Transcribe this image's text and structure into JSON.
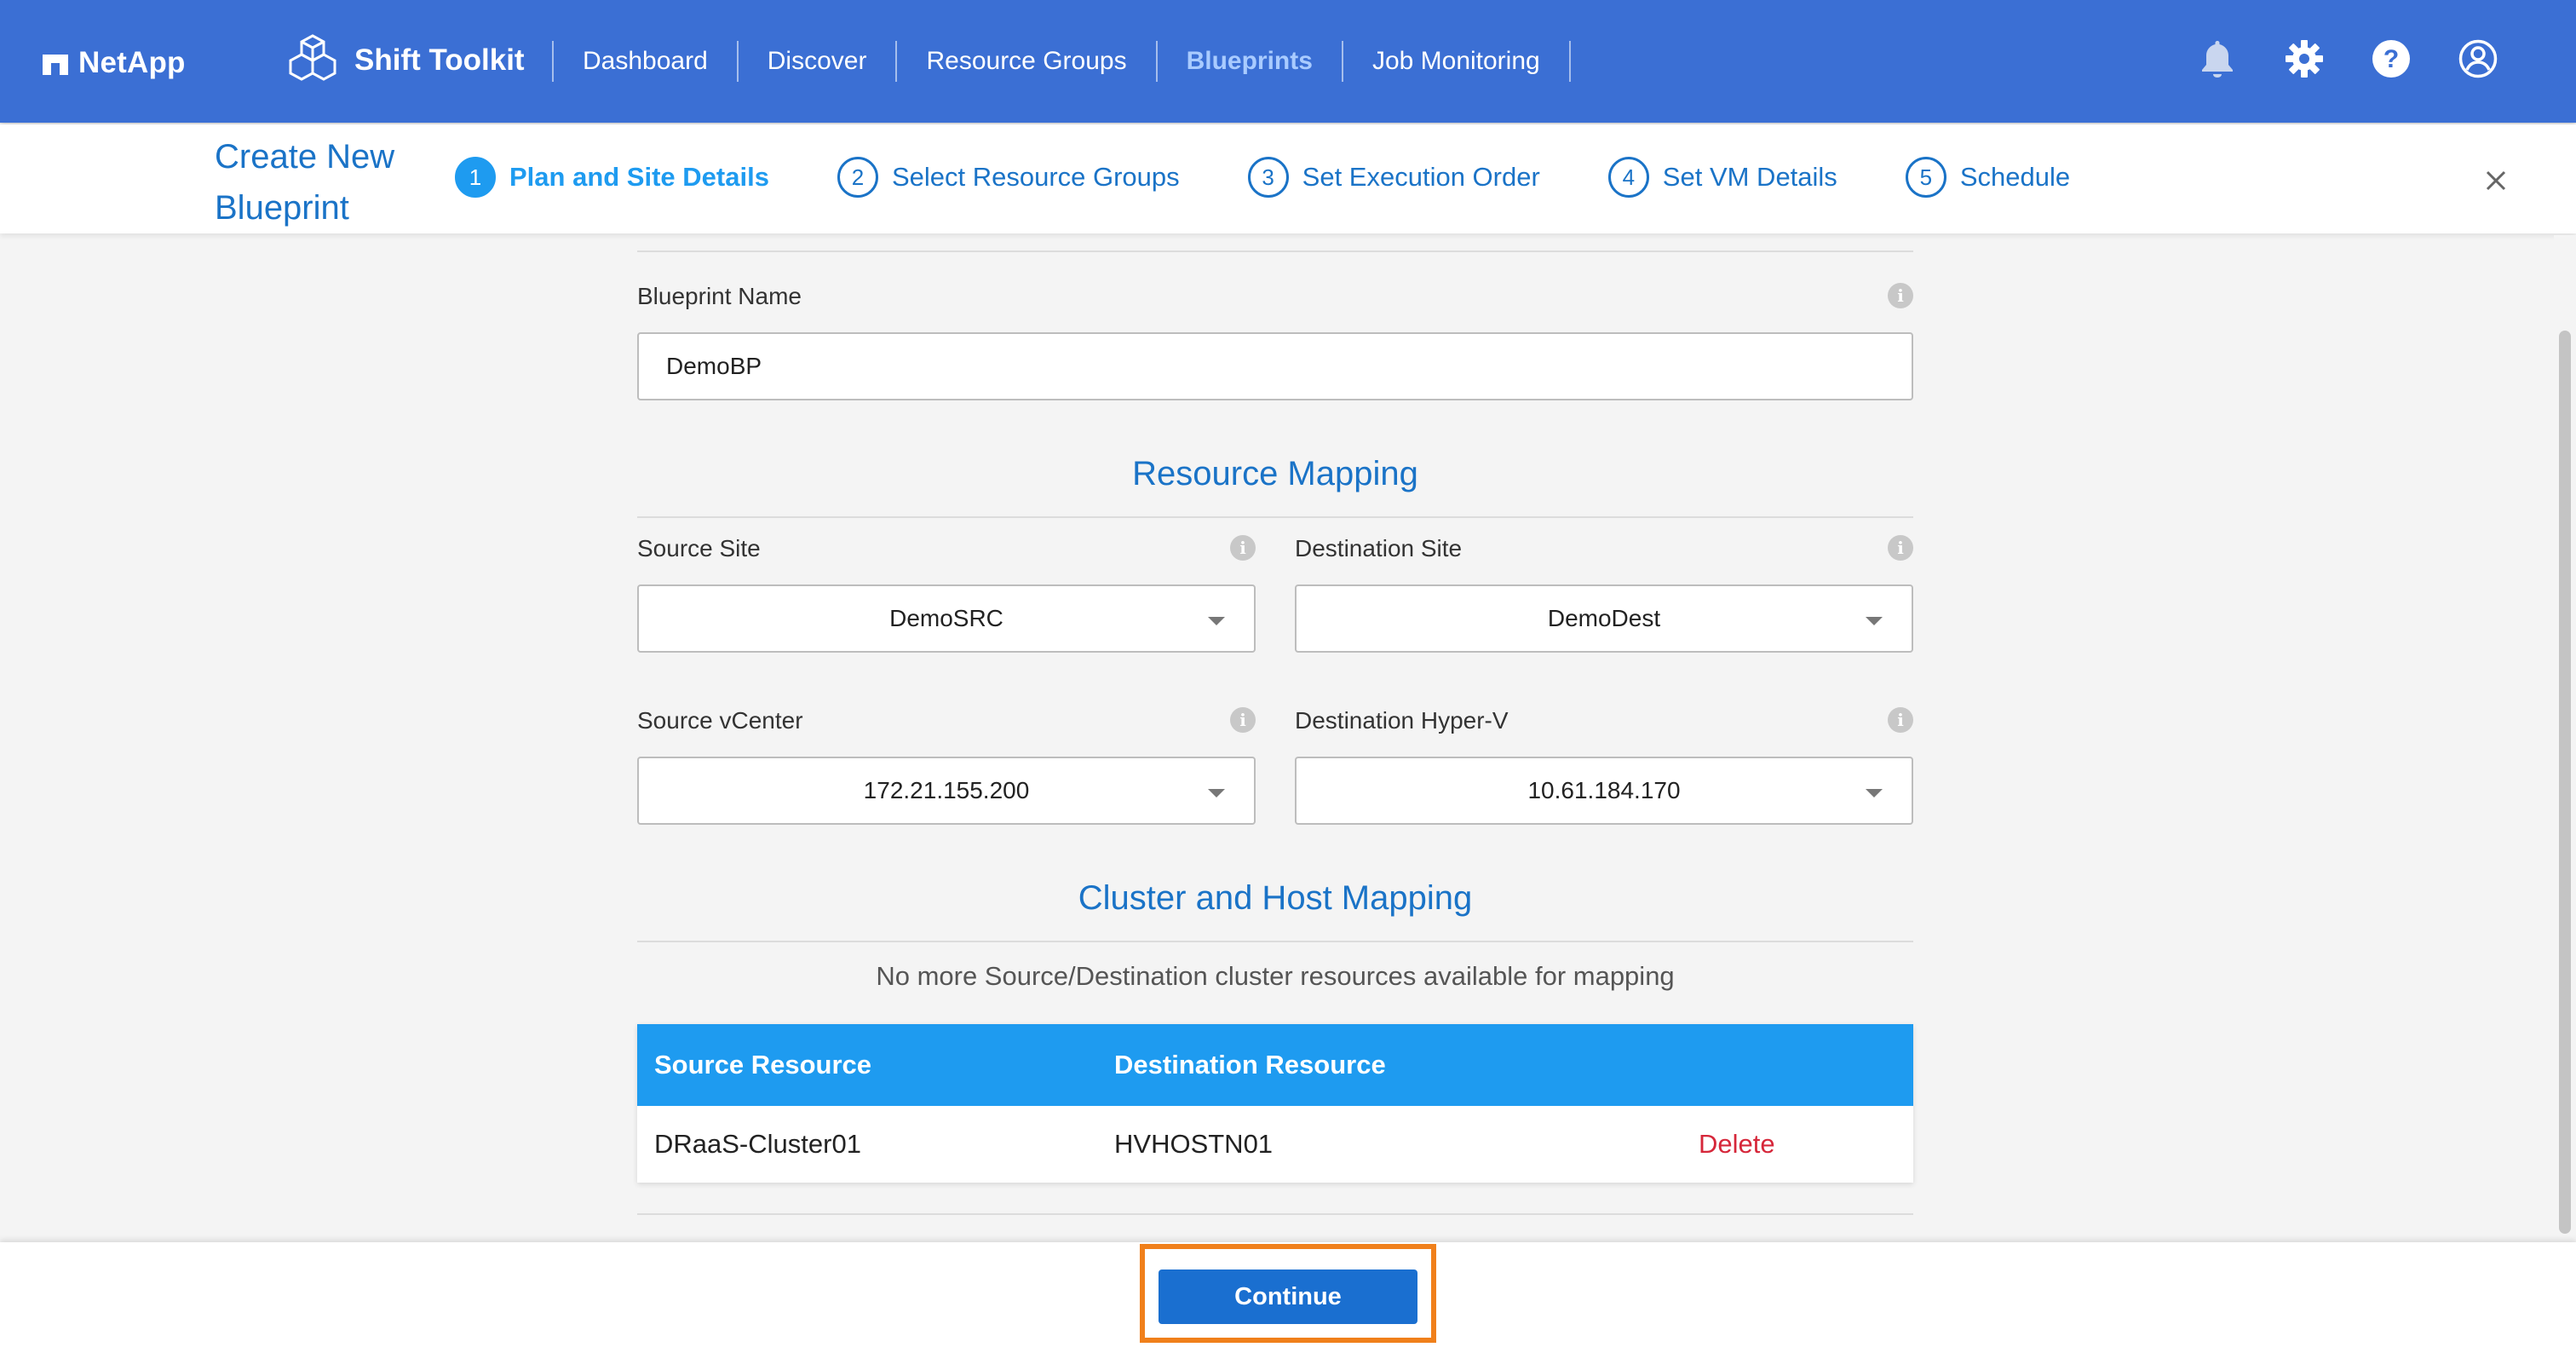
{
  "topnav": {
    "brand": "NetApp",
    "product": "Shift Toolkit",
    "links": [
      "Dashboard",
      "Discover",
      "Resource Groups",
      "Blueprints",
      "Job Monitoring"
    ],
    "active_link": "Blueprints",
    "icons": [
      "bell-icon",
      "gear-icon",
      "help-icon",
      "user-icon"
    ]
  },
  "wizard": {
    "title": "Create New Blueprint",
    "steps": [
      {
        "num": "1",
        "label": "Plan and Site Details"
      },
      {
        "num": "2",
        "label": "Select Resource Groups"
      },
      {
        "num": "3",
        "label": "Set Execution Order"
      },
      {
        "num": "4",
        "label": "Set VM Details"
      },
      {
        "num": "5",
        "label": "Schedule"
      }
    ],
    "active_step": 1
  },
  "form": {
    "blueprint_name_label": "Blueprint Name",
    "blueprint_name_value": "DemoBP",
    "resource_mapping_title": "Resource Mapping",
    "source_site_label": "Source Site",
    "source_site_value": "DemoSRC",
    "destination_site_label": "Destination Site",
    "destination_site_value": "DemoDest",
    "source_vcenter_label": "Source vCenter",
    "source_vcenter_value": "172.21.155.200",
    "destination_hyperv_label": "Destination Hyper-V",
    "destination_hyperv_value": "10.61.184.170",
    "cluster_mapping_title": "Cluster and Host Mapping",
    "cluster_mapping_hint": "No more Source/Destination cluster resources available for mapping"
  },
  "mapping_table": {
    "headers": [
      "Source Resource",
      "Destination Resource"
    ],
    "rows": [
      {
        "source": "DRaaS-Cluster01",
        "destination": "HVHOSTN01",
        "action": "Delete"
      }
    ]
  },
  "footer": {
    "continue_label": "Continue"
  },
  "colors": {
    "nav_bg": "#3b6fd4",
    "accent": "#1e9bf0",
    "link_blue": "#1a73c7",
    "delete_red": "#d6273a",
    "highlight_orange": "#f0801b"
  }
}
